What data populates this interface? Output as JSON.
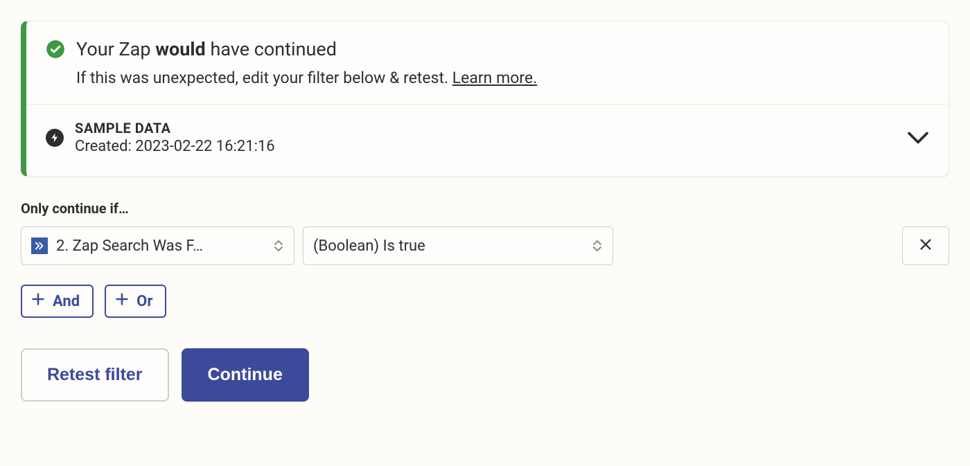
{
  "alert": {
    "heading_prefix": "Your Zap ",
    "heading_bold": "would",
    "heading_suffix": " have continued",
    "subtext_prefix": "If this was unexpected, edit your filter below & retest. ",
    "learn_more_label": "Learn more."
  },
  "sample_data": {
    "title": "SAMPLE DATA",
    "created_prefix": "Created: ",
    "created_value": "2023-02-22 16:21:16"
  },
  "filter": {
    "section_label": "Only continue if…",
    "field_label": "2. Zap Search Was F…",
    "operator_label": "(Boolean) Is true",
    "and_label": "And",
    "or_label": "Or"
  },
  "actions": {
    "retest_label": "Retest filter",
    "continue_label": "Continue"
  },
  "colors": {
    "accent_green": "#3d9943",
    "accent_blue": "#3b4b9a"
  }
}
